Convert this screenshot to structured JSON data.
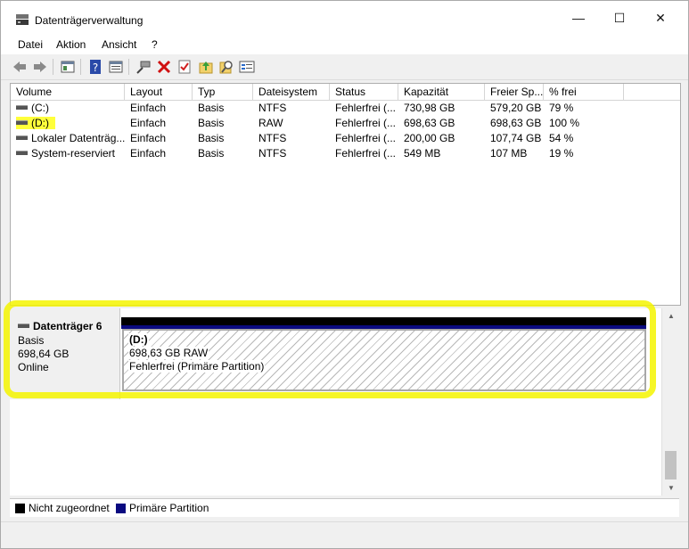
{
  "window": {
    "title": "Datenträgerverwaltung",
    "controls": {
      "minimize": "—",
      "maximize": "☐",
      "close": "✕"
    }
  },
  "menu": [
    "Datei",
    "Aktion",
    "Ansicht",
    "?"
  ],
  "toolbar_icons": [
    "back-arrow-icon",
    "forward-arrow-icon",
    "console-tree-icon",
    "help-icon",
    "properties-icon",
    "connect-icon",
    "delete-icon",
    "check-icon",
    "folder-up-icon",
    "search-icon",
    "settings-list-icon"
  ],
  "volume_list": {
    "columns": [
      "Volume",
      "Layout",
      "Typ",
      "Dateisystem",
      "Status",
      "Kapazität",
      "Freier Sp...",
      "% frei"
    ],
    "rows": [
      [
        "(C:)",
        "Einfach",
        "Basis",
        "NTFS",
        "Fehlerfrei (...",
        "730,98 GB",
        "579,20 GB",
        "79 %"
      ],
      [
        "(D:)",
        "Einfach",
        "Basis",
        "RAW",
        "Fehlerfrei (...",
        "698,63 GB",
        "698,63 GB",
        "100 %"
      ],
      [
        "Lokaler Datenträg...",
        "Einfach",
        "Basis",
        "NTFS",
        "Fehlerfrei (...",
        "200,00 GB",
        "107,74 GB",
        "54 %"
      ],
      [
        "System-reserviert",
        "Einfach",
        "Basis",
        "NTFS",
        "Fehlerfrei (...",
        "549 MB",
        "107 MB",
        "19 %"
      ]
    ]
  },
  "disk": {
    "name": "Datenträger 6",
    "type": "Basis",
    "size": "698,64 GB",
    "state": "Online",
    "partition": {
      "letter": "(D:)",
      "size_fs": "698,63 GB RAW",
      "status": "Fehlerfrei (Primäre Partition)"
    }
  },
  "legend": {
    "unallocated": "Nicht zugeordnet",
    "primary": "Primäre Partition",
    "unallocated_color": "#000000",
    "primary_color": "#0a0a80"
  },
  "highlight_color": "#f5f500"
}
